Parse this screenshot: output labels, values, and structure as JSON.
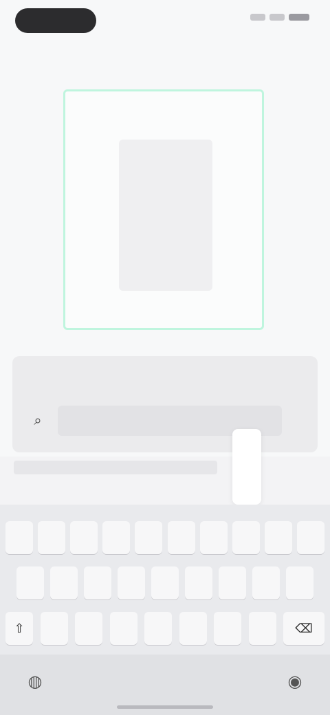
{
  "status": {
    "time": "",
    "icons": [
      "signal-icon",
      "wifi-icon",
      "battery-icon"
    ]
  },
  "screen": {
    "title": ""
  },
  "scanner": {
    "card_label": "",
    "frame_color": "#bff5de"
  },
  "panel": {
    "label": "",
    "search_value": "",
    "search_placeholder": "",
    "action_label": ""
  },
  "suggestions": {
    "right_text": "",
    "items": [
      "",
      "",
      "",
      "",
      "",
      "",
      ""
    ],
    "items_right": [
      "",
      ""
    ]
  },
  "popup": {
    "key": ""
  },
  "keyboard": {
    "row1": [
      "",
      "",
      "",
      "",
      "",
      "",
      "",
      "",
      "",
      ""
    ],
    "row2": [
      "",
      "",
      "",
      "",
      "",
      "",
      "",
      "",
      ""
    ],
    "row3": [
      "",
      "",
      "",
      "",
      "",
      "",
      "",
      "",
      ""
    ],
    "mode_label": "",
    "emoji_label": "",
    "space_label": "",
    "enter_label": ""
  }
}
